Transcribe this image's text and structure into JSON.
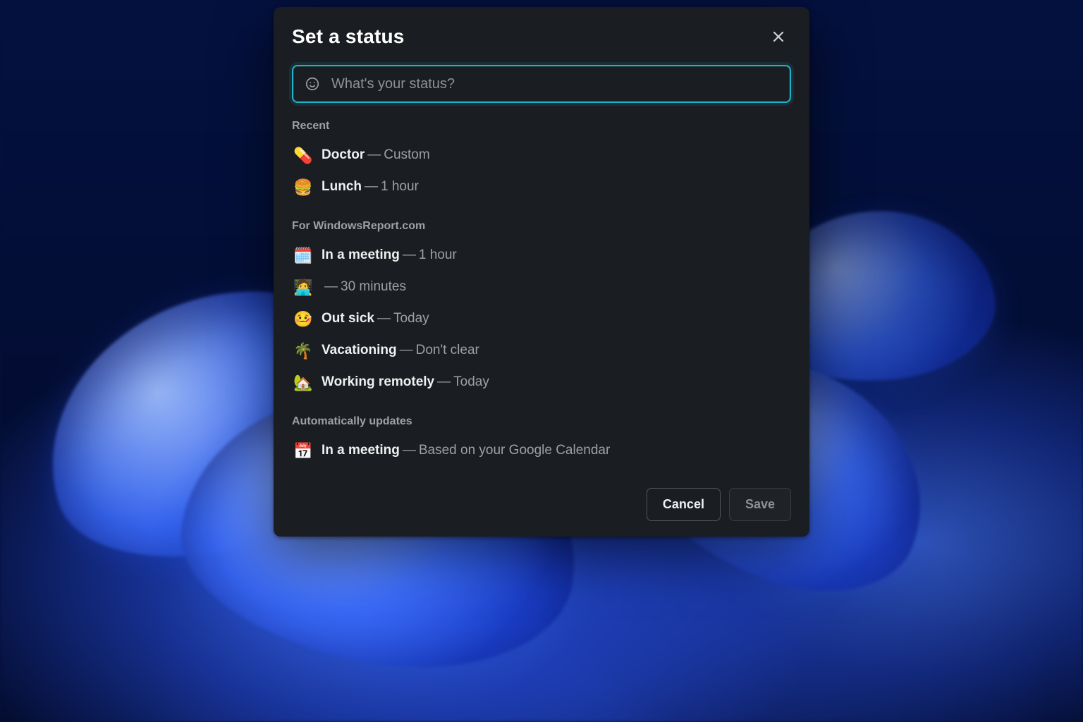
{
  "modal": {
    "title": "Set a status",
    "input": {
      "placeholder": "What's your status?"
    },
    "buttons": {
      "cancel": "Cancel",
      "save": "Save"
    }
  },
  "sections": {
    "recent": {
      "label": "Recent",
      "items": [
        {
          "emoji": "💊",
          "label": "Doctor",
          "duration": "Custom"
        },
        {
          "emoji": "🍔",
          "label": "Lunch",
          "duration": "1 hour"
        }
      ]
    },
    "workspace": {
      "label": "For WindowsReport.com",
      "items": [
        {
          "emoji": "🗓️",
          "label": "In a meeting",
          "duration": "1 hour"
        },
        {
          "emoji": "🧑‍💻",
          "label": "",
          "duration": "30 minutes"
        },
        {
          "emoji": "🤒",
          "label": "Out sick",
          "duration": "Today"
        },
        {
          "emoji": "🌴",
          "label": "Vacationing",
          "duration": "Don't clear"
        },
        {
          "emoji": "🏡",
          "label": "Working remotely",
          "duration": "Today"
        }
      ]
    },
    "auto": {
      "label": "Automatically updates",
      "items": [
        {
          "emoji": "📅",
          "label": "In a meeting",
          "duration": "Based on your Google Calendar"
        }
      ]
    }
  }
}
